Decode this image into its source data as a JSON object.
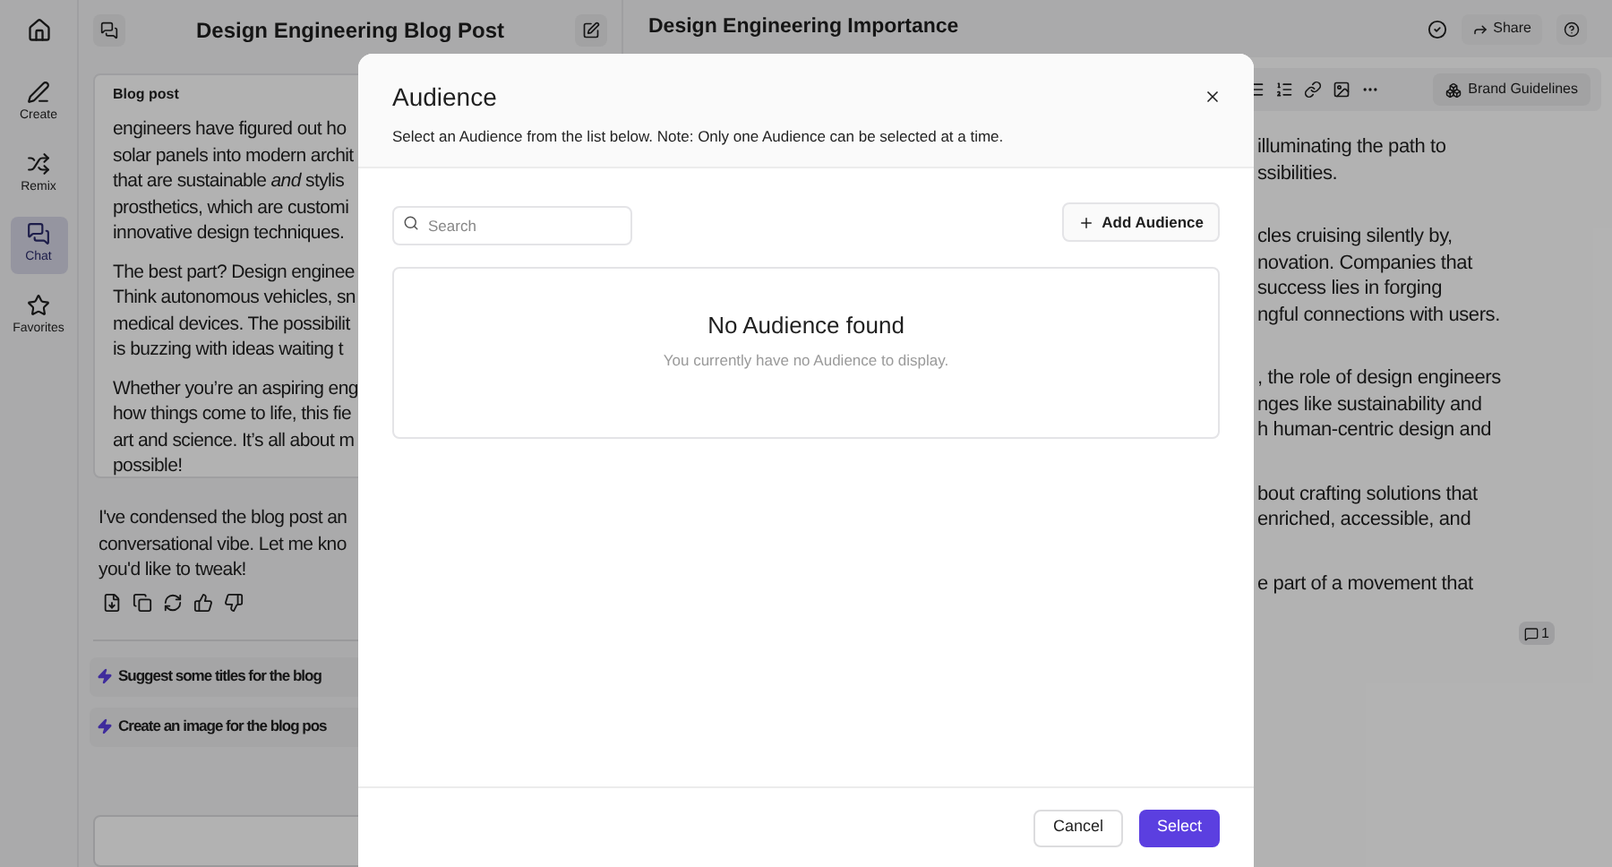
{
  "sidebar": {
    "items": [
      {
        "label": "Create",
        "kind": "create",
        "selected": false
      },
      {
        "label": "Remix",
        "kind": "remix",
        "selected": false
      },
      {
        "label": "Chat",
        "kind": "chat",
        "selected": true
      },
      {
        "label": "Favorites",
        "kind": "favorites",
        "selected": false
      }
    ]
  },
  "chat": {
    "title": "Design Engineering Blog Post",
    "card": {
      "label": "Blog post",
      "paragraphs": [
        [
          "engineers have figured out ho",
          "solar panels into modern archit",
          "that are sustainable *and* stylis",
          "prosthetics, which are customi",
          "innovative design techniques."
        ],
        [
          "The best part? Design enginee",
          "Think autonomous vehicles, sn",
          "medical devices. The possibilit",
          "is buzzing with ideas waiting t"
        ],
        [
          "Whether you’re an aspiring eng",
          "how things come to life, this fie",
          "art and science. It’s all about m",
          "possible!"
        ]
      ]
    },
    "message": [
      "I've condensed the blog post an",
      "conversational vibe. Let me kno",
      "you'd like to tweak!"
    ],
    "suggestions": [
      "Suggest some titles for the blog",
      "Create an image for the blog pos"
    ]
  },
  "editor": {
    "title": "Design Engineering Importance",
    "share": "Share",
    "brand_button": "Brand Guidelines",
    "paragraphs": [
      [
        "illuminating the path to",
        "ssibilities."
      ],
      [
        "cles cruising silently by,",
        "novation. Companies that",
        "success lies in forging",
        "ngful connections with users."
      ],
      [
        ", the role of design engineers",
        "nges like sustainability and",
        "h human-centric design and"
      ],
      [
        "bout crafting solutions that",
        "enriched, accessible, and"
      ],
      [
        "e part of a movement that"
      ]
    ],
    "comment_count": "1"
  },
  "dialog": {
    "title": "Audience",
    "subtitle": "Select an Audience from the list below. Note: Only one Audience can be selected at a time.",
    "search": {
      "placeholder": "Search"
    },
    "add_button": "Add Audience",
    "empty_title": "No Audience found",
    "empty_text": "You currently have no Audience to display.",
    "buttons": [
      {
        "label": "Cancel",
        "kind": "secondary"
      },
      {
        "label": "Select",
        "kind": "primary"
      }
    ]
  }
}
